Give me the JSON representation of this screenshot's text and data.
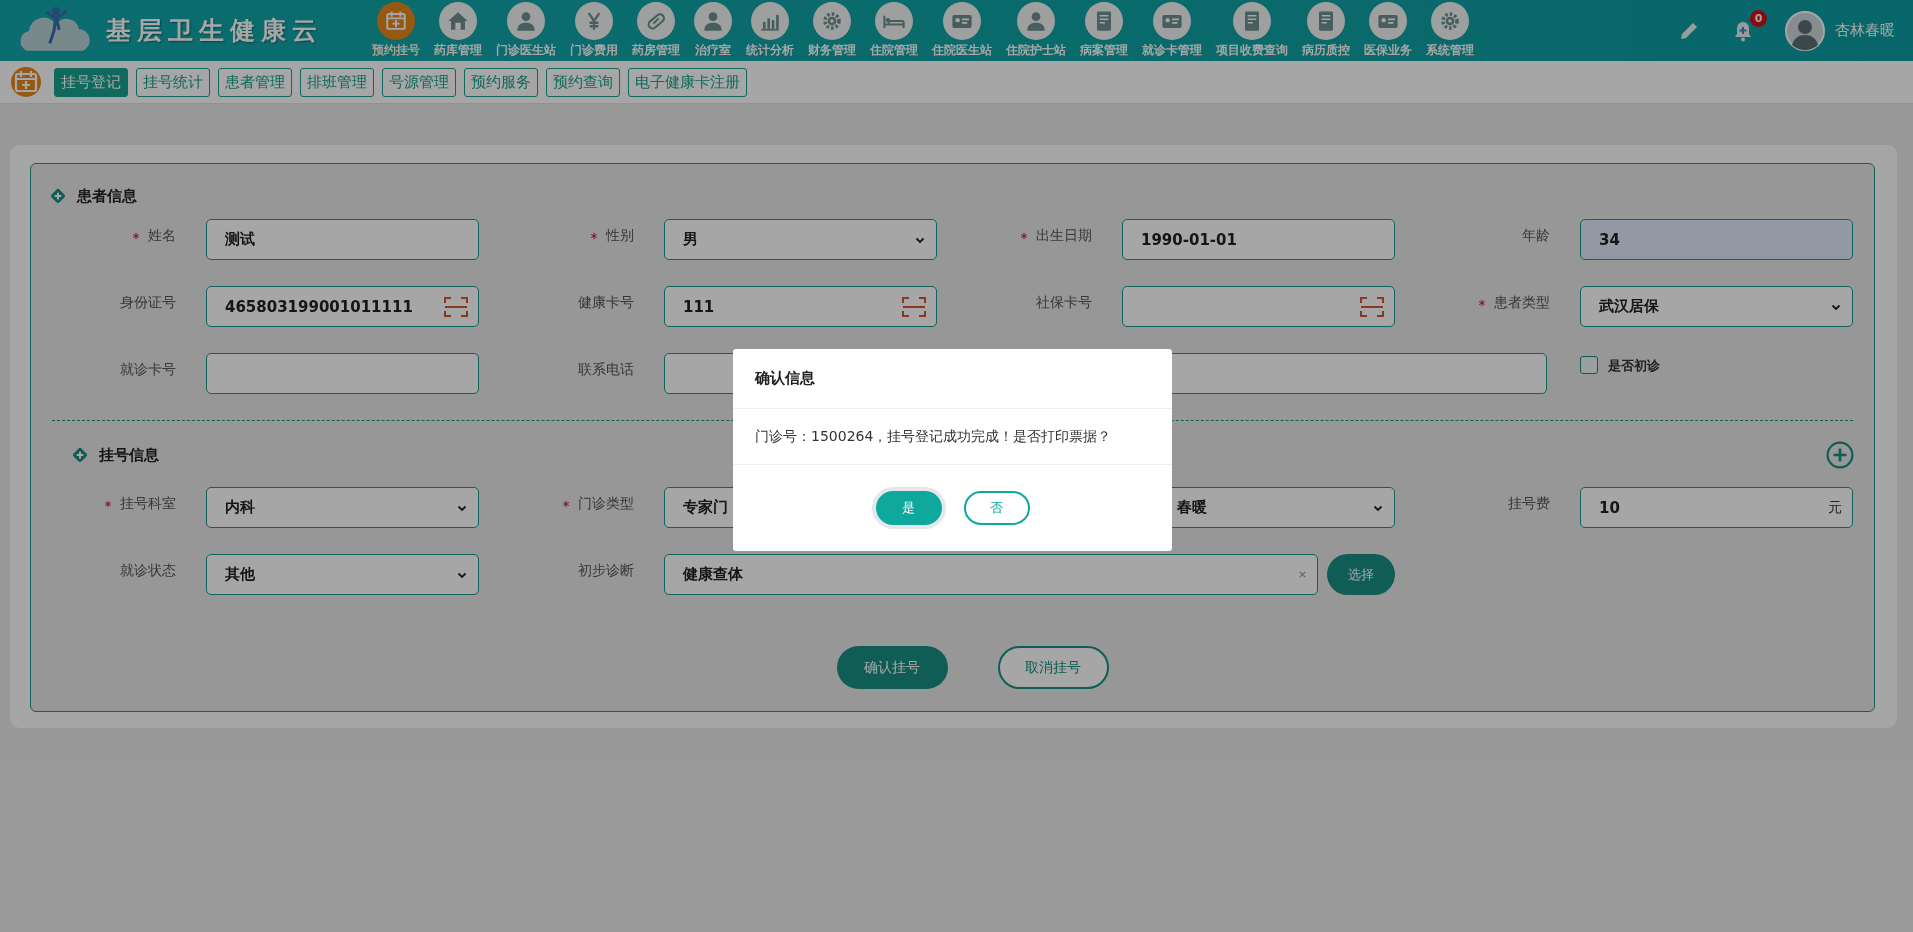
{
  "header": {
    "logo_text": "基层卫生健康云",
    "nav": [
      {
        "label": "预约挂号",
        "selected": true
      },
      {
        "label": "药库管理",
        "selected": false
      },
      {
        "label": "门诊医生站",
        "selected": false
      },
      {
        "label": "门诊费用",
        "selected": false
      },
      {
        "label": "药房管理",
        "selected": false
      },
      {
        "label": "治疗室",
        "selected": false
      },
      {
        "label": "统计分析",
        "selected": false
      },
      {
        "label": "财务管理",
        "selected": false
      },
      {
        "label": "住院管理",
        "selected": false
      },
      {
        "label": "住院医生站",
        "selected": false
      },
      {
        "label": "住院护士站",
        "selected": false
      },
      {
        "label": "病案管理",
        "selected": false
      },
      {
        "label": "就诊卡管理",
        "selected": false
      },
      {
        "label": "项目收费查询",
        "selected": false
      },
      {
        "label": "病历质控",
        "selected": false
      },
      {
        "label": "医保业务",
        "selected": false
      },
      {
        "label": "系统管理",
        "selected": false
      }
    ],
    "notification_count": "0",
    "user_name": "杏林春暖"
  },
  "subnav": {
    "tabs": [
      {
        "label": "挂号登记",
        "selected": true
      },
      {
        "label": "挂号统计",
        "selected": false
      },
      {
        "label": "患者管理",
        "selected": false
      },
      {
        "label": "排班管理",
        "selected": false
      },
      {
        "label": "号源管理",
        "selected": false
      },
      {
        "label": "预约服务",
        "selected": false
      },
      {
        "label": "预约查询",
        "selected": false
      },
      {
        "label": "电子健康卡注册",
        "selected": false
      }
    ]
  },
  "sections": [
    {
      "title": "患者信息",
      "add_button": false,
      "fields": [
        {
          "kind": "text",
          "label": "姓名",
          "required": true,
          "value": "测试"
        },
        {
          "kind": "select",
          "label": "性别",
          "required": true,
          "value": "男"
        },
        {
          "kind": "text",
          "label": "出生日期",
          "required": true,
          "value": "1990-01-01"
        },
        {
          "kind": "readonly",
          "label": "年龄",
          "required": false,
          "value": "34"
        },
        {
          "kind": "scan",
          "label": "身份证号",
          "required": false,
          "value": "465803199001011111"
        },
        {
          "kind": "scan",
          "label": "健康卡号",
          "required": false,
          "value": "111"
        },
        {
          "kind": "scan",
          "label": "社保卡号",
          "required": false
        },
        {
          "kind": "select",
          "label": "患者类型",
          "required": true,
          "value": "武汉居保"
        },
        {
          "kind": "text",
          "label": "就诊卡号",
          "required": false
        },
        {
          "kind": "text",
          "label": "联系电话",
          "required": false
        },
        {
          "kind": "wide"
        },
        {
          "kind": "checkbox",
          "label": "是否初诊",
          "checked": false
        }
      ]
    },
    {
      "title": "挂号信息",
      "add_button": true,
      "fields": [
        {
          "kind": "select",
          "label": "挂号科室",
          "required": true,
          "value": "内科"
        },
        {
          "kind": "select-head",
          "label": "门诊类型",
          "required": true,
          "value": "专家门"
        },
        {
          "kind": "select-tail",
          "value": "春暖"
        },
        {
          "kind": "unit",
          "label": "挂号费",
          "required": false,
          "value": "10",
          "unit": "元"
        },
        {
          "kind": "select",
          "label": "就诊状态",
          "required": false,
          "value": "其他"
        },
        {
          "kind": "search",
          "label": "初步诊断",
          "required": false,
          "value": "健康查体",
          "button": "选择"
        }
      ]
    }
  ],
  "actions": [
    {
      "label": "确认挂号",
      "kind": "primary"
    },
    {
      "label": "取消挂号",
      "kind": "secondary"
    }
  ],
  "dialog": {
    "title": "确认信息",
    "message": "门诊号：1500264，挂号登记成功完成！是否打印票据？",
    "buttons": [
      {
        "label": "是",
        "kind": "primary"
      },
      {
        "label": "否",
        "kind": "secondary"
      }
    ]
  }
}
